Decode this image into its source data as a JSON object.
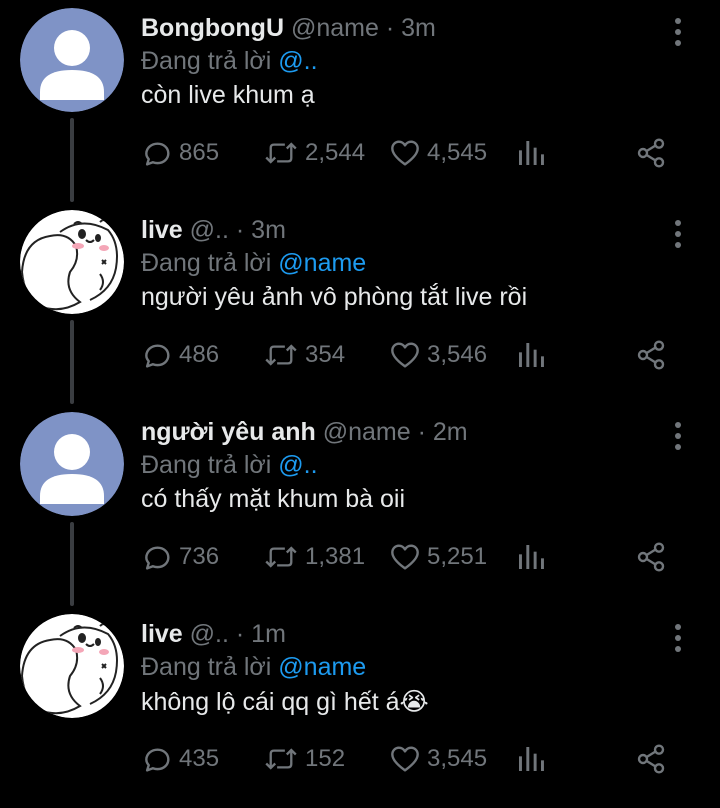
{
  "colors": {
    "background": "#000000",
    "name": "#e7e9ea",
    "secondary": "#71767b",
    "mention": "#1d9bf0",
    "thread_line": "#3a3d41"
  },
  "tweets": [
    {
      "avatar": "default-avatar",
      "name": "BongbongU",
      "handle": "@name",
      "separator": "·",
      "time": "3m",
      "replying_prefix": "Đang trả lời",
      "replying_to": "@..",
      "text": "còn live khum ạ",
      "reply_count": "865",
      "retweet_count": "2,544",
      "like_count": "4,545"
    },
    {
      "avatar": "cartoon-avatar",
      "name": "live",
      "handle": "@..",
      "separator": "·",
      "time": "3m",
      "replying_prefix": "Đang trả lời",
      "replying_to": "@name",
      "text": "người yêu ảnh vô phòng tắt live rồi",
      "reply_count": "486",
      "retweet_count": "354",
      "like_count": "3,546"
    },
    {
      "avatar": "default-avatar",
      "name": "người yêu anh",
      "handle": "@name",
      "separator": "·",
      "time": "2m",
      "replying_prefix": "Đang trả lời",
      "replying_to": "@..",
      "text": "có thấy mặt khum bà oii",
      "reply_count": "736",
      "retweet_count": "1,381",
      "like_count": "5,251"
    },
    {
      "avatar": "cartoon-avatar",
      "name": "live",
      "handle": "@..",
      "separator": "·",
      "time": "1m",
      "replying_prefix": "Đang trả lời",
      "replying_to": "@name",
      "text": "không lộ cái qq gì hết á😭",
      "reply_count": "435",
      "retweet_count": "152",
      "like_count": "3,545"
    }
  ]
}
